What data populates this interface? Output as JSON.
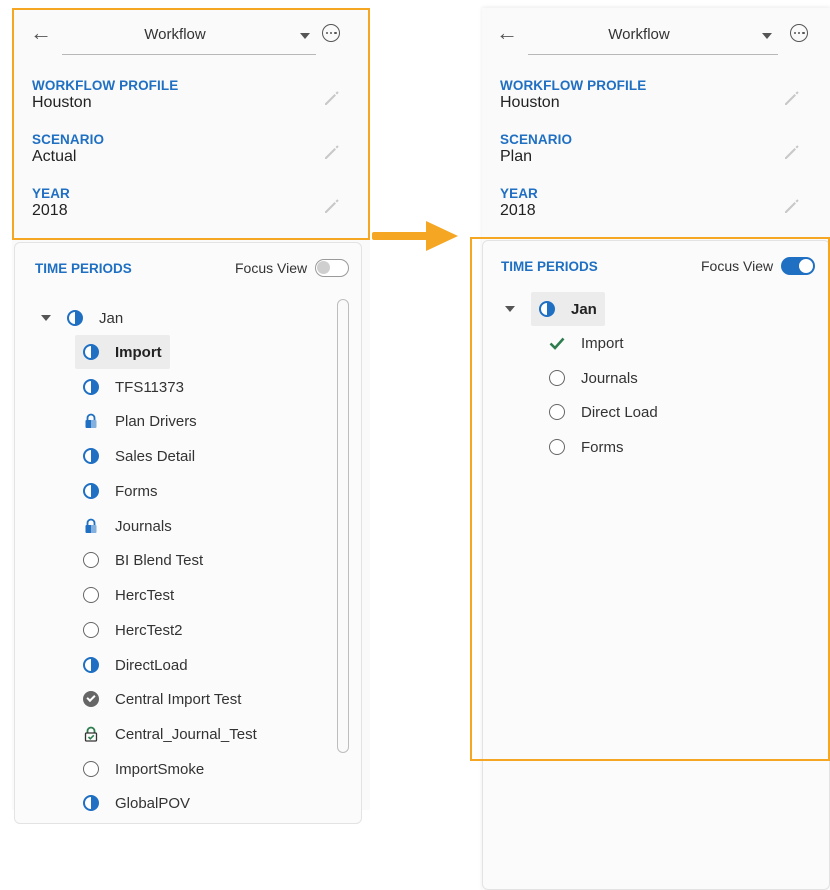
{
  "colors": {
    "accent": "#1f6fc3",
    "highlight": "#f5a623",
    "check_green": "#2e7d4f"
  },
  "left": {
    "header": {
      "title": "Workflow",
      "back_icon": "back-arrow-icon",
      "more_icon": "more-options-icon"
    },
    "fields": [
      {
        "label": "WORKFLOW PROFILE",
        "value": "Houston"
      },
      {
        "label": "SCENARIO",
        "value": "Actual"
      },
      {
        "label": "YEAR",
        "value": "2018"
      }
    ],
    "time_periods": {
      "title": "TIME PERIODS",
      "focus_view_label": "Focus View",
      "focus_view_on": false,
      "root": {
        "label": "Jan",
        "status": "partial"
      },
      "items": [
        {
          "label": "Import",
          "status": "partial",
          "selected": true
        },
        {
          "label": "TFS11373",
          "status": "partial"
        },
        {
          "label": "Plan Drivers",
          "status": "locked"
        },
        {
          "label": "Sales Detail",
          "status": "partial"
        },
        {
          "label": "Forms",
          "status": "partial"
        },
        {
          "label": "Journals",
          "status": "locked"
        },
        {
          "label": "BI Blend Test",
          "status": "empty"
        },
        {
          "label": "HercTest",
          "status": "empty"
        },
        {
          "label": "HercTest2",
          "status": "empty"
        },
        {
          "label": "DirectLoad",
          "status": "partial"
        },
        {
          "label": "Central Import Test",
          "status": "completed"
        },
        {
          "label": "Central_Journal_Test",
          "status": "locked-certified"
        },
        {
          "label": "ImportSmoke",
          "status": "empty"
        },
        {
          "label": "GlobalPOV",
          "status": "partial"
        }
      ]
    }
  },
  "right": {
    "header": {
      "title": "Workflow",
      "back_icon": "back-arrow-icon",
      "more_icon": "more-options-icon"
    },
    "fields": [
      {
        "label": "WORKFLOW PROFILE",
        "value": "Houston"
      },
      {
        "label": "SCENARIO",
        "value": "Plan"
      },
      {
        "label": "YEAR",
        "value": "2018"
      }
    ],
    "time_periods": {
      "title": "TIME PERIODS",
      "focus_view_label": "Focus View",
      "focus_view_on": true,
      "root": {
        "label": "Jan",
        "status": "partial",
        "selected": true
      },
      "items": [
        {
          "label": "Import",
          "status": "check"
        },
        {
          "label": "Journals",
          "status": "empty"
        },
        {
          "label": "Direct Load",
          "status": "empty"
        },
        {
          "label": "Forms",
          "status": "empty"
        }
      ]
    }
  }
}
